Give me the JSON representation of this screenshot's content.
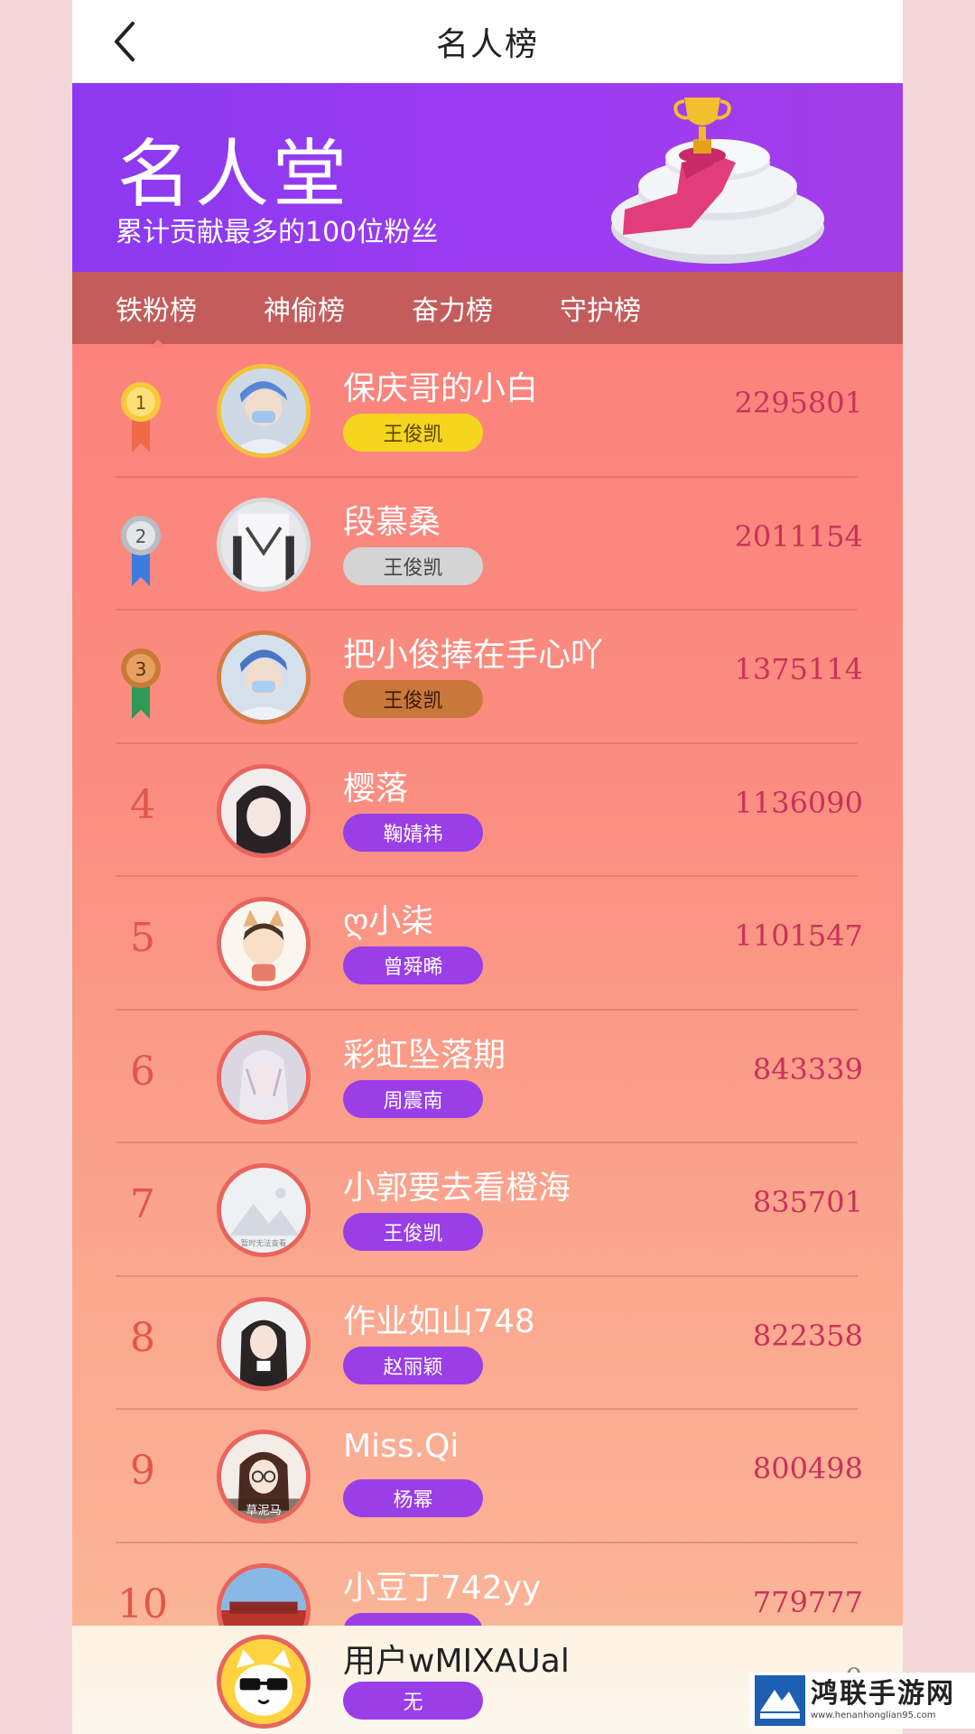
{
  "navbar": {
    "title": "名人榜"
  },
  "hero": {
    "title": "名人堂",
    "subtitle": "累计贡献最多的100位粉丝"
  },
  "tabs": [
    {
      "label": "铁粉榜",
      "active": true
    },
    {
      "label": "神偷榜",
      "active": false
    },
    {
      "label": "奋力榜",
      "active": false
    },
    {
      "label": "守护榜",
      "active": false
    }
  ],
  "colors": {
    "badge_gold": "#f5d51d",
    "badge_silver": "#d4d4d4",
    "badge_bronze": "#c8783a",
    "badge_purple": "#9a3ee8",
    "score": "#c9325a",
    "rank": "#e2564a"
  },
  "rows": [
    {
      "rank": "1",
      "medal": "gold-medal-icon",
      "name": "保庆哥的小白",
      "badge": "王俊凯",
      "badge_style": "gold",
      "score": "2295801"
    },
    {
      "rank": "2",
      "medal": "silver-medal-icon",
      "name": "段慕桑",
      "badge": "王俊凯",
      "badge_style": "silver",
      "score": "2011154"
    },
    {
      "rank": "3",
      "medal": "bronze-medal-icon",
      "name": "把小俊捧在手心吖",
      "badge": "王俊凯",
      "badge_style": "bronze",
      "score": "1375114"
    },
    {
      "rank": "4",
      "name": "樱落",
      "badge": "鞠婧祎",
      "badge_style": "purple",
      "score": "1136090"
    },
    {
      "rank": "5",
      "name": "ღ小柒",
      "badge": "曾舜晞",
      "badge_style": "purple",
      "score": "1101547"
    },
    {
      "rank": "6",
      "name": "彩虹坠落期",
      "badge": "周震南",
      "badge_style": "purple",
      "score": "843339"
    },
    {
      "rank": "7",
      "name": "小郭要去看橙海",
      "badge": "王俊凯",
      "badge_style": "purple",
      "score": "835701",
      "avatar_caption": "暂时无法查看"
    },
    {
      "rank": "8",
      "name": "作业如山748",
      "badge": "赵丽颖",
      "badge_style": "purple",
      "score": "822358"
    },
    {
      "rank": "9",
      "name": "Miss.Qi",
      "badge": "杨幂",
      "badge_style": "purple",
      "score": "800498",
      "avatar_caption": "草泥马"
    },
    {
      "rank": "10",
      "name": "小豆丁742yy",
      "badge": "",
      "badge_style": "purple",
      "score": "779777"
    }
  ],
  "my_rank": {
    "name": "用户wMIXAUal",
    "badge": "无",
    "score": "0"
  },
  "watermark": {
    "name": "鸿联手游网",
    "url": "www.henanhonglian95.com"
  }
}
